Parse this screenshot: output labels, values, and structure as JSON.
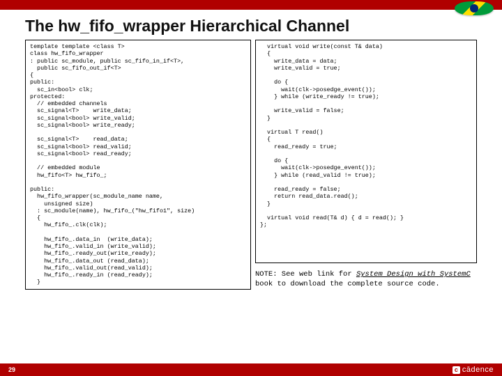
{
  "slide": {
    "title": "The hw_fifo_wrapper Hierarchical Channel",
    "page_number": "29",
    "brand": "cādence"
  },
  "code_left": "template template <class T>\nclass hw_fifo_wrapper\n: public sc_module, public sc_fifo_in_if<T>,\n  public sc_fifo_out_if<T>\n{\npublic:\n  sc_in<bool> clk;\nprotected:\n  // embedded channels\n  sc_signal<T>    write_data;\n  sc_signal<bool> write_valid;\n  sc_signal<bool> write_ready;\n\n  sc_signal<T>    read_data;\n  sc_signal<bool> read_valid;\n  sc_signal<bool> read_ready;\n\n  // embedded module\n  hw_fifo<T> hw_fifo_;\n\npublic:\n  hw_fifo_wrapper(sc_module_name name,\n    unsigned size)\n  : sc_module(name), hw_fifo_(\"hw_fifo1\", size)\n  {\n    hw_fifo_.clk(clk);\n\n    hw_fifo_.data_in  (write_data);\n    hw_fifo_.valid_in (write_valid);\n    hw_fifo_.ready_out(write_ready);\n    hw_fifo_.data_out (read_data);\n    hw_fifo_.valid_out(read_valid);\n    hw_fifo_.ready_in (read_ready);\n  }",
  "code_right": "  virtual void write(const T& data)\n  {\n    write_data = data;\n    write_valid = true;\n\n    do {\n      wait(clk->posedge_event());\n    } while (write_ready != true);\n\n    write_valid = false;\n  }\n\n  virtual T read()\n  {\n    read_ready = true;\n\n    do {\n      wait(clk->posedge_event());\n    } while (read_valid != true);\n\n    read_ready = false;\n    return read_data.read();\n  }\n\n  virtual void read(T& d) { d = read(); }\n};",
  "note": {
    "prefix": "NOTE: See web link for ",
    "link1": "System Design with SystemC",
    "suffix": " book to download the complete source code."
  }
}
